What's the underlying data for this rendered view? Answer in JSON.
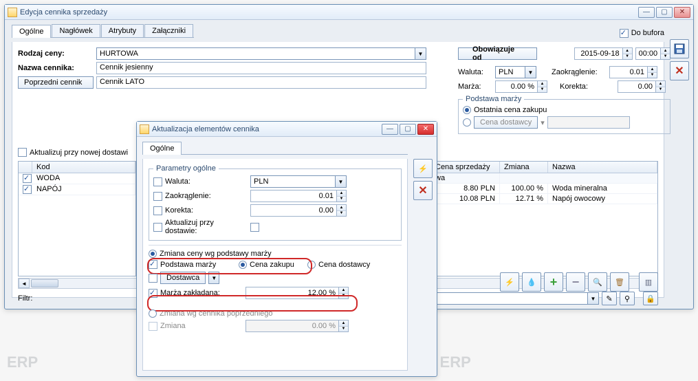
{
  "main_window": {
    "title": "Edycja cennika sprzedaży",
    "tabs": [
      "Ogólne",
      "Nagłówek",
      "Atrybuty",
      "Załączniki"
    ],
    "do_bufora": "Do bufora",
    "rodzaj_ceny_label": "Rodzaj ceny:",
    "rodzaj_ceny_value": "HURTOWA",
    "nazwa_cennika_label": "Nazwa cennika:",
    "nazwa_cennika_value": "Cennik jesienny",
    "poprzedni_cennik_btn": "Poprzedni cennik",
    "poprzedni_cennik_value": "Cennik LATO",
    "obowiazuje_od_btn": "Obowiązuje od",
    "date_value": "2015-09-18",
    "time_value": "00:00",
    "waluta_label": "Waluta:",
    "waluta_value": "PLN",
    "zaokraglenie_label": "Zaokrąglenie:",
    "zaokraglenie_value": "0.01",
    "marza_label": "Marża:",
    "marza_value": "0.00 %",
    "korekta_label": "Korekta:",
    "korekta_value": "0.00",
    "podstawa_marzy_legend": "Podstawa marży",
    "ostatnia_cena_zakupu": "Ostatnia cena zakupu",
    "cena_dostawcy_btn": "Cena dostawcy",
    "aktualizuj_label": "Aktualizuj przy nowej dostawi",
    "filtr_label": "Filtr:",
    "grid": {
      "headers": {
        "kod": "Kod",
        "cena": "Cena sprzedaży",
        "wa": "wa",
        "zmiana": "Zmiana",
        "nazwa": "Nazwa"
      },
      "rows": [
        {
          "kod": "WODA",
          "cena": "8.80 PLN",
          "zmiana": "100.00 %",
          "nazwa": "Woda mineralna"
        },
        {
          "kod": "NAPÓJ",
          "cena": "10.08 PLN",
          "zmiana": "12.71 %",
          "nazwa": "Napój owocowy"
        }
      ]
    }
  },
  "sub_window": {
    "title": "Aktualizacja elementów cennika",
    "tab": "Ogólne",
    "param_legend": "Parametry ogólne",
    "waluta_label": "Waluta:",
    "waluta_value": "PLN",
    "zaokraglenie_label": "Zaokrąglenie:",
    "zaokraglenie_value": "0.01",
    "korekta_label": "Korekta:",
    "korekta_value": "0.00",
    "aktualizuj_label": "Aktualizuj przy dostawie:",
    "zmiana_wg_podstawy": "Zmiana ceny wg podstawy marży",
    "podstawa_marzy": "Podstawa marży",
    "cena_zakupu": "Cena zakupu",
    "cena_dostawcy": "Cena dostawcy",
    "dostawca_btn": "Dostawca",
    "marza_zakladana": "Marża zakładana:",
    "marza_zakladana_value": "12.00 %",
    "zmiana_wg_poprz": "Zmiana wg cennika poprzedniego",
    "zmiana_label": "Zmiana",
    "zmiana_value": "0.00 %"
  },
  "watermark": "ERP"
}
